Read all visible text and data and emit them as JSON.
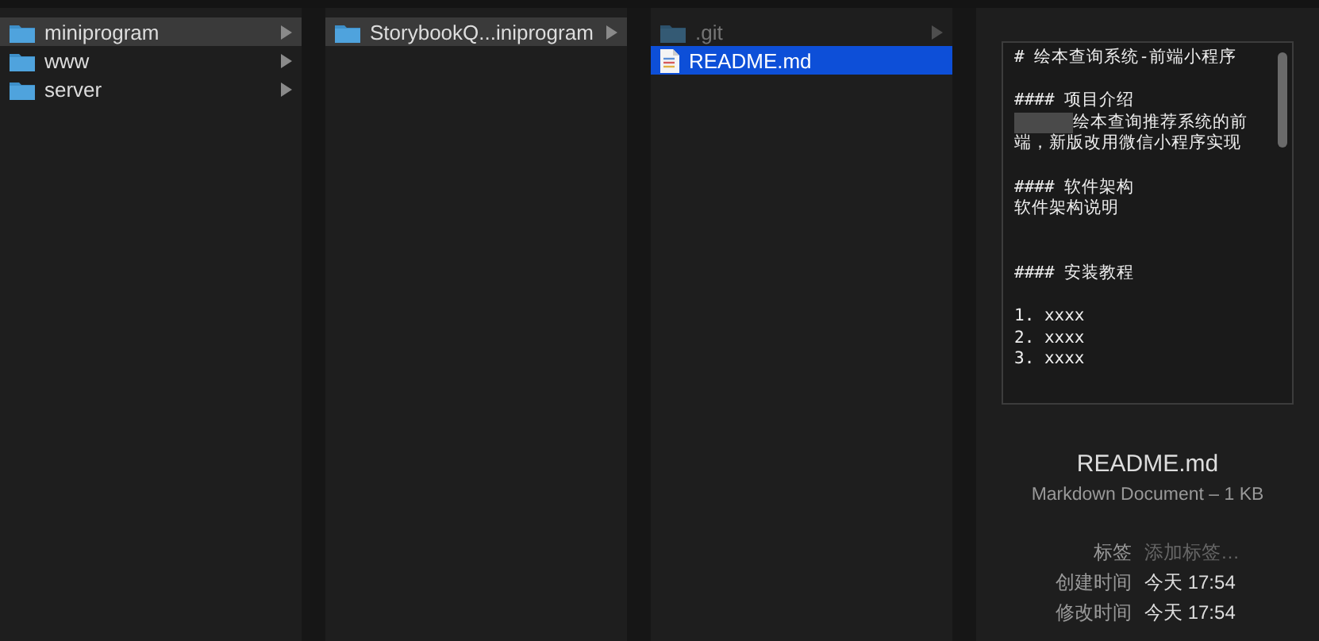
{
  "columns": [
    {
      "focused": false,
      "items": [
        {
          "name": "miniprogram",
          "kind": "folder",
          "selected": true,
          "hidden": false,
          "has_children": true
        },
        {
          "name": "www",
          "kind": "folder",
          "selected": false,
          "hidden": false,
          "has_children": true
        },
        {
          "name": "server",
          "kind": "folder",
          "selected": false,
          "hidden": false,
          "has_children": true
        }
      ]
    },
    {
      "focused": false,
      "items": [
        {
          "name": "StorybookQ...iniprogram",
          "kind": "folder",
          "selected": true,
          "hidden": false,
          "has_children": true
        }
      ]
    },
    {
      "focused": true,
      "items": [
        {
          "name": ".git",
          "kind": "folder",
          "selected": false,
          "hidden": true,
          "has_children": true
        },
        {
          "name": "README.md",
          "kind": "document",
          "selected": true,
          "hidden": false,
          "has_children": false
        }
      ]
    }
  ],
  "preview": {
    "paragraphs": [
      {
        "lines": [
          {
            "text": "# 绘本查询系统-前端小程序",
            "redacted": false
          }
        ]
      },
      {
        "extra_gap_before": false,
        "lines": [
          {
            "text": "#### 项目介绍",
            "redacted": false
          },
          {
            "text": "绘本查询推荐系统的前",
            "redacted": true
          },
          {
            "text": "端，新版改用微信小程序实现",
            "redacted": false
          }
        ]
      },
      {
        "extra_gap_before": false,
        "lines": [
          {
            "text": "#### 软件架构",
            "redacted": false
          },
          {
            "text": "软件架构说明",
            "redacted": false
          }
        ]
      },
      {
        "extra_gap_before": true,
        "lines": [
          {
            "text": "#### 安装教程",
            "redacted": false
          }
        ]
      },
      {
        "extra_gap_before": false,
        "lines": [
          {
            "text": "1. xxxx",
            "redacted": false
          },
          {
            "text": "2. xxxx",
            "redacted": false
          },
          {
            "text": "3. xxxx",
            "redacted": false
          }
        ]
      }
    ]
  },
  "info": {
    "name": "README.md",
    "type": "Markdown Document – 1 KB",
    "fields": [
      {
        "label": "标签",
        "placeholder": "添加标签…"
      },
      {
        "label": "创建时间",
        "value": "今天 17:54"
      },
      {
        "label": "修改时间",
        "value": "今天 17:54"
      }
    ]
  }
}
